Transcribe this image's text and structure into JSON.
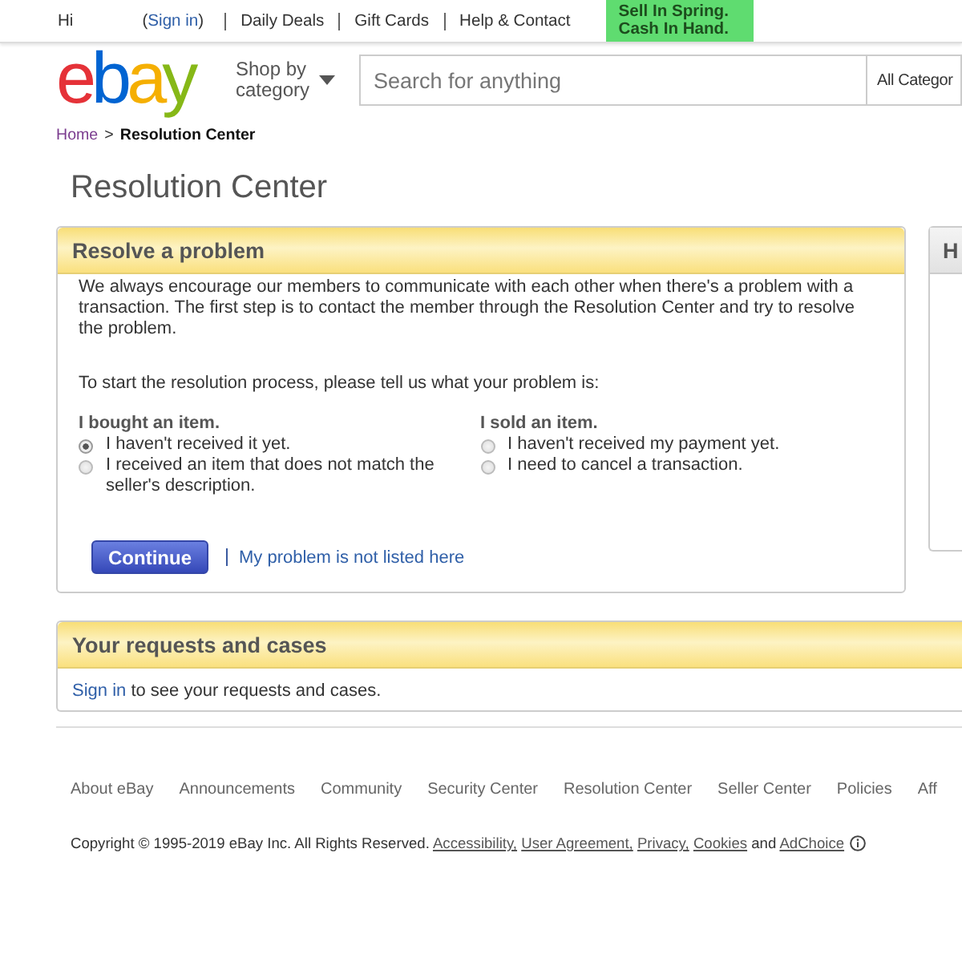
{
  "top_bar": {
    "greeting": "Hi",
    "sign_in": {
      "before": "(",
      "link": "Sign in",
      "after": ")"
    },
    "links": [
      "Daily Deals",
      "Gift Cards",
      "Help & Contact"
    ],
    "promo": [
      "Sell In Spring.",
      "Cash In Hand."
    ]
  },
  "header": {
    "logo": "ebay",
    "shop_by_category": "Shop by category",
    "search": {
      "placeholder": "Search for anything"
    },
    "category_dropdown": "All Categor"
  },
  "breadcrumb": {
    "separator": ">",
    "items": [
      {
        "label": "Home",
        "kind": "link"
      },
      {
        "label": "Resolution Center",
        "kind": "current"
      }
    ]
  },
  "page_title": "Resolution Center",
  "resolve_panel": {
    "title": "Resolve a problem",
    "intro": "We always encourage our members to communicate with each other when there's a problem with a transaction. The first step is to contact the member through the Resolution Center and try to resolve the problem.",
    "prompt": "To start the resolution process, please tell us what your problem is:",
    "groups": [
      {
        "heading": "I bought an item.",
        "options": [
          {
            "label": "I haven't received it yet.",
            "selected": true
          },
          {
            "label": "I received an item that does not match the seller's description.",
            "selected": false
          }
        ]
      },
      {
        "heading": "I sold an item.",
        "options": [
          {
            "label": "I haven't received my payment yet.",
            "selected": false
          },
          {
            "label": "I need to cancel a transaction.",
            "selected": false
          }
        ]
      }
    ],
    "button": "Continue",
    "link": "My problem is not listed here"
  },
  "side_panel": {
    "title": "H"
  },
  "requests_panel": {
    "title": "Your requests and cases",
    "link": "Sign in",
    "text": "to see your requests and cases."
  },
  "footer": {
    "links": [
      "About eBay",
      "Announcements",
      "Community",
      "Security Center",
      "Resolution Center",
      "Seller Center",
      "Policies",
      "Aff"
    ],
    "copyright": [
      {
        "kind": "text",
        "text": "Copyright © 1995-2019 eBay Inc. All Rights Reserved."
      },
      {
        "kind": "link",
        "text": "Accessibility,"
      },
      {
        "kind": "link",
        "text": "User Agreement,"
      },
      {
        "kind": "link",
        "text": "Privacy,"
      },
      {
        "kind": "link",
        "text": "Cookies"
      },
      {
        "kind": "text",
        "text": "and"
      },
      {
        "kind": "link",
        "text": "AdChoice"
      }
    ]
  }
}
